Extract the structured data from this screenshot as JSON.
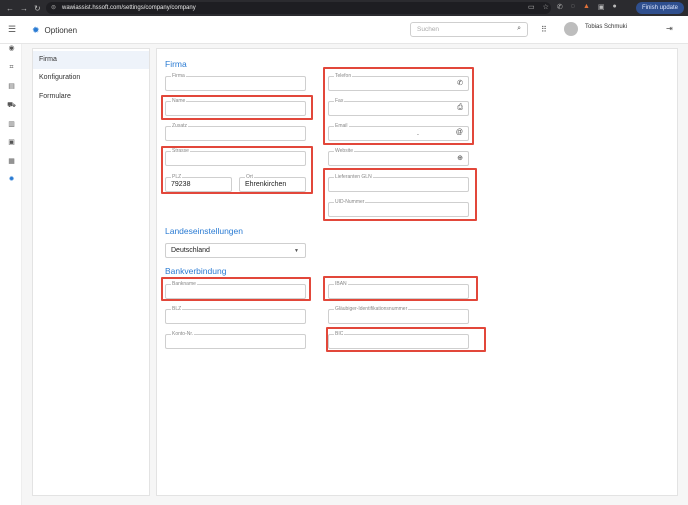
{
  "browser": {
    "url": "wawiassist.hssoft.com/settings/company/company",
    "finish_update_label": "Finish update"
  },
  "header": {
    "title": "Optionen",
    "search_placeholder": "Suchen",
    "user_name": "Tobias Schmuki"
  },
  "rail": {
    "icons": [
      "user-icon",
      "scan-icon",
      "briefcase-icon",
      "cart-icon",
      "truck-icon",
      "money-icon",
      "clipboard-icon",
      "gear-icon"
    ]
  },
  "menu": {
    "items": [
      {
        "label": "Firma",
        "active": true
      },
      {
        "label": "Konfiguration",
        "active": false
      },
      {
        "label": "Formulare",
        "active": false
      }
    ]
  },
  "sections": {
    "firma": "Firma",
    "landes": "Landeseinstellungen",
    "bank": "Bankverbindung"
  },
  "fields": {
    "firma": {
      "label": "Firma",
      "value": ""
    },
    "name": {
      "label": "Name",
      "value": ""
    },
    "zusatz": {
      "label": "Zusatz",
      "value": ""
    },
    "strasse": {
      "label": "Strasse",
      "value": ""
    },
    "plz": {
      "label": "PLZ",
      "value": "79238"
    },
    "ort": {
      "label": "Ort",
      "value": "Ehrenkirchen"
    },
    "telefon": {
      "label": "Telefon",
      "value": ""
    },
    "fax": {
      "label": "Fax",
      "value": ""
    },
    "email": {
      "label": "Email",
      "value": "."
    },
    "website": {
      "label": "Website",
      "value": ""
    },
    "gln": {
      "label": "Lieferanten GLN",
      "value": ""
    },
    "uid": {
      "label": "UID-Nummer",
      "value": ""
    },
    "land": {
      "label": "",
      "value": "Deutschland"
    },
    "bankname": {
      "label": "Bankname",
      "value": ""
    },
    "blz": {
      "label": "BLZ",
      "value": ""
    },
    "konto": {
      "label": "Konto-Nr.",
      "value": ""
    },
    "iban": {
      "label": "IBAN",
      "value": ""
    },
    "glaeubiger": {
      "label": "Gläubiger-Identifikationsnummer",
      "value": ""
    },
    "bic": {
      "label": "BIC",
      "value": ""
    }
  },
  "colors": {
    "accent": "#2a7bd3",
    "highlight": "#e2473a"
  }
}
